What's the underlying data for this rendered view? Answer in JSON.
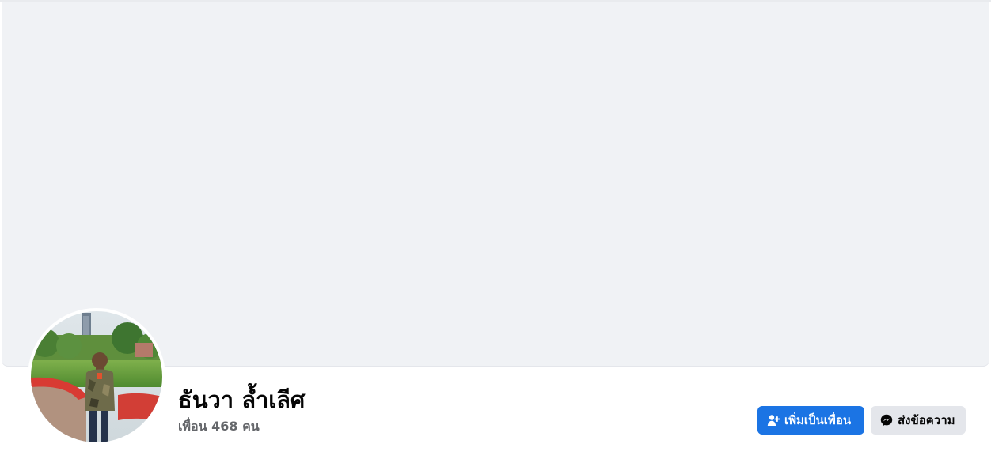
{
  "profile": {
    "name": "ธันวา ล้ำเลีศ",
    "friends": "เพื่อน 468 คน"
  },
  "actions": {
    "add_friend_label": "เพิ่มเป็นเพื่อน",
    "message_label": "ส่งข้อความ",
    "add_friend_icon": "add-friend-icon",
    "message_icon": "messenger-icon"
  },
  "colors": {
    "cover_bg": "#f0f2f5",
    "primary": "#1b74e4",
    "secondary_button": "#e4e6eb",
    "muted_text": "#65676b"
  }
}
